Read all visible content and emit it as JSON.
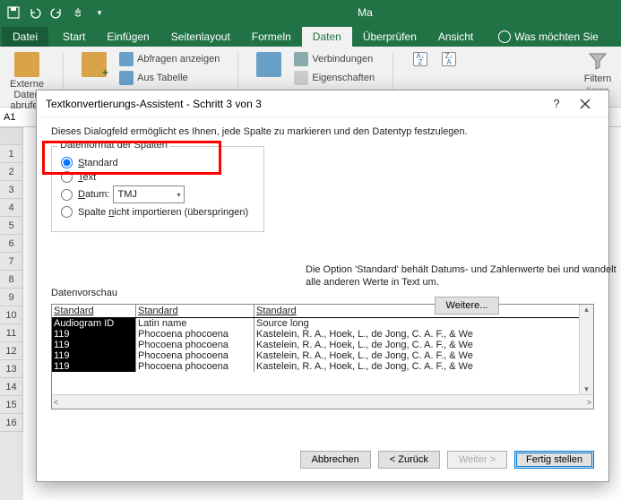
{
  "titlebar": {
    "app_title_fragment": "Ma"
  },
  "ribbon": {
    "file": "Datei",
    "tabs": [
      "Start",
      "Einfügen",
      "Seitenlayout",
      "Formeln",
      "Daten",
      "Überprüfen",
      "Ansicht"
    ],
    "active_tab_index": 4,
    "tell_me": "Was möchten Sie",
    "externe_daten": "Externe Daten abrufen",
    "abfragen_anzeigen": "Abfragen anzeigen",
    "aus_tabelle": "Aus Tabelle",
    "verbindungen": "Verbindungen",
    "eigenschaften": "Eigenschaften",
    "filtern": "Filtern",
    "tieren": "tieren"
  },
  "namebox": "A1",
  "rows": [
    "1",
    "2",
    "3",
    "4",
    "5",
    "6",
    "7",
    "8",
    "9",
    "10",
    "11",
    "12",
    "13",
    "14",
    "15",
    "16"
  ],
  "dialog": {
    "title": "Textkonvertierungs-Assistent - Schritt 3 von 3",
    "description": "Dieses Dialogfeld ermöglicht es Ihnen, jede Spalte zu markieren und den Datentyp festzulegen.",
    "group_label": "Datenformat der Spalten",
    "opt_standard": "Standard",
    "opt_text": "Text",
    "opt_datum": "Datum:",
    "date_format": "TMJ",
    "opt_skip": "Spalte nicht importieren (überspringen)",
    "info_text": "Die Option 'Standard' behält Datums- und Zahlenwerte bei und wandelt alle anderen Werte in Text um.",
    "btn_weitere": "Weitere...",
    "preview_label": "Datenvorschau",
    "col_headers": [
      "Standard",
      "Standard",
      "Standard"
    ],
    "rows": [
      {
        "c1": "Audiogram ID",
        "c2": "Latin name",
        "c3": "Source long"
      },
      {
        "c1": "119",
        "c2": "Phocoena phocoena",
        "c3": "Kastelein, R. A., Hoek, L., de Jong, C. A. F., & We"
      },
      {
        "c1": "119",
        "c2": "Phocoena phocoena",
        "c3": "Kastelein, R. A., Hoek, L., de Jong, C. A. F., & We"
      },
      {
        "c1": "119",
        "c2": "Phocoena phocoena",
        "c3": "Kastelein, R. A., Hoek, L., de Jong, C. A. F., & We"
      },
      {
        "c1": "119",
        "c2": "Phocoena phocoena",
        "c3": "Kastelein, R. A., Hoek, L., de Jong, C. A. F., & We"
      }
    ],
    "btn_cancel": "Abbrechen",
    "btn_back": "< Zurück",
    "btn_next": "Weiter >",
    "btn_finish": "Fertig stellen"
  }
}
